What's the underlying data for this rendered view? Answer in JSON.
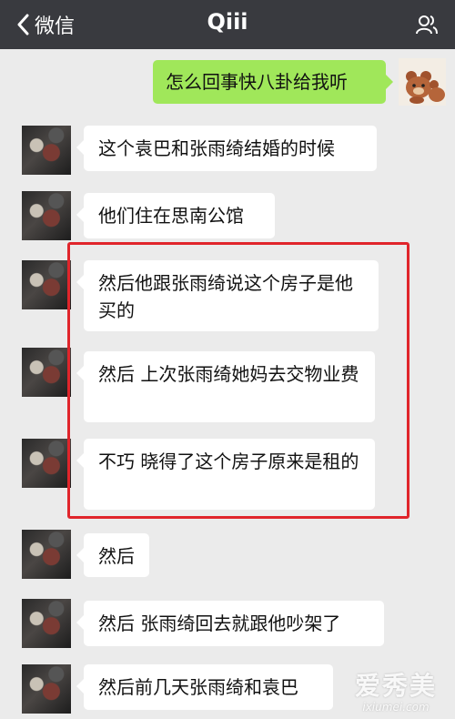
{
  "header": {
    "back_label": "微信",
    "title": "Qiii"
  },
  "messages": {
    "outgoing": "怎么回事快八卦给我听",
    "incoming": [
      "这个袁巴和张雨绮结婚的时候",
      "他们住在思南公馆",
      "然后他跟张雨绮说这个房子是他买的",
      "然后 上次张雨绮她妈去交物业费",
      "不巧 晓得了这个房子原来是租的",
      "然后",
      "然后 张雨绮回去就跟他吵架了",
      "然后前几天张雨绮和袁巴"
    ]
  },
  "watermark": {
    "main": "爱秀美",
    "sub": "ixiumei.com"
  },
  "colors": {
    "header_bg": "#393a3f",
    "chat_bg": "#ebebeb",
    "outgoing_bubble": "#a0e75a",
    "incoming_bubble": "#ffffff",
    "highlight_border": "#e0252b"
  },
  "icons": [
    "back-chevron-icon",
    "more-people-icon"
  ]
}
